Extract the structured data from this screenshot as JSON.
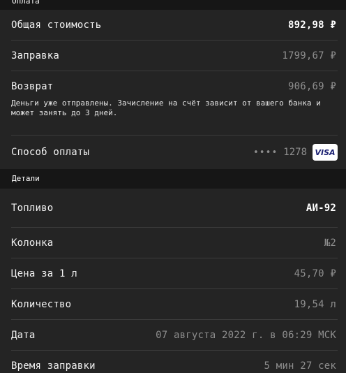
{
  "payment": {
    "header": "Оплата",
    "total_label": "Общая стоимость",
    "total_value": "892,98 ₽",
    "refuel_label": "Заправка",
    "refuel_value": "1799,67 ₽",
    "refund_label": "Возврат",
    "refund_value": "906,69 ₽",
    "refund_note": "Деньги уже отправлены. Зачисление на счёт зависит от вашего банка и может занять до 3 дней.",
    "method_label": "Способ оплаты",
    "card_dots": "••••",
    "card_last4": "1278",
    "card_brand": "VISA"
  },
  "details": {
    "header": "Детали",
    "fuel_label": "Топливо",
    "fuel_value": "АИ-92",
    "pump_label": "Колонка",
    "pump_value": "№2",
    "price_label": "Цена за 1 л",
    "price_value": "45,70 ₽",
    "qty_label": "Количество",
    "qty_value": "19,54 л",
    "date_label": "Дата",
    "date_value": "07 августа 2022 г. в 06:29 МСК",
    "time_label": "Время заправки",
    "time_value": "5 мин 27 сек"
  }
}
